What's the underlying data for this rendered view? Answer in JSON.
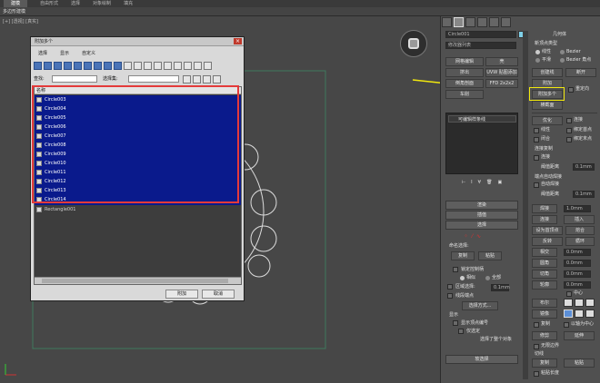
{
  "top_menu": [
    "建模",
    "自由形式",
    "选择",
    "对象绘制",
    "填充"
  ],
  "sub_bar": "多边形建模",
  "viewport_label": "[+] [透视] [真实]",
  "dialog": {
    "title": "附加多个",
    "menu": [
      "选择",
      "显示",
      "自定义"
    ],
    "find_label": "查找:",
    "selection_set_label": "选择集:",
    "list_header": "名称",
    "items": [
      {
        "name": "Circle003",
        "selected": true
      },
      {
        "name": "Circle004",
        "selected": true
      },
      {
        "name": "Circle005",
        "selected": true
      },
      {
        "name": "Circle006",
        "selected": true
      },
      {
        "name": "Circle007",
        "selected": true
      },
      {
        "name": "Circle008",
        "selected": true
      },
      {
        "name": "Circle009",
        "selected": true
      },
      {
        "name": "Circle010",
        "selected": true
      },
      {
        "name": "Circle011",
        "selected": true
      },
      {
        "name": "Circle012",
        "selected": true
      },
      {
        "name": "Circle013",
        "selected": true
      },
      {
        "name": "Circle014",
        "selected": true
      },
      {
        "name": "Rectangle001",
        "selected": false
      }
    ],
    "attach_button": "附加",
    "cancel_button": "取消"
  },
  "panel": {
    "object_name": "Circle001",
    "modifier_list": "修改器列表",
    "buttons_left": [
      "网格编辑",
      "挤出",
      "倒角剖面",
      "车削"
    ],
    "buttons_mid": [
      "壳",
      "UVW 贴图添加",
      "FFD 2x2x2",
      ""
    ],
    "stack_item": "可编辑样条线",
    "rollout_render": "渲染",
    "rollout_interp": "插值",
    "rollout_select": "选择",
    "rollout_soft": "软选择",
    "title_geom": "几何体",
    "new_vertex_type": "新顶点类型",
    "radio_linear": "线性",
    "radio_bezier": "Bezier",
    "radio_smooth": "平滑",
    "radio_bezier_corner": "Bezier 角点",
    "create_line": "创建线",
    "break": "断开",
    "attach": "附加",
    "attach_multiple": "附加多个",
    "reorient": "重定向",
    "cross_section": "横截面",
    "optimize": "优化",
    "connect": "连接",
    "linear": "线性",
    "bind_first": "绑定首点",
    "closed": "闭合",
    "bind_last": "绑定末点",
    "connect_copy": "连接复制",
    "threshold": "阈值距离",
    "threshold_value": "0.1mm",
    "end_auto_weld": "端点自动焊接",
    "auto_weld": "自动焊接",
    "weld_threshold": "阈值距离",
    "weld": "焊接",
    "weld_value": "0.1mm",
    "connect_btn": "连接",
    "insert": "插入",
    "set_first": "设为首顶点",
    "fuse": "熔合",
    "reverse": "反转",
    "cycle": "循环",
    "cross": "相交",
    "fillet": "圆角",
    "fillet_value": "0.0mm",
    "chamfer": "切角",
    "chamfer_value": "0.0mm",
    "outline": "轮廓",
    "outline_value": "0.0mm",
    "center": "中心",
    "boolean": "布尔",
    "mirror": "镜像",
    "copy": "复制",
    "about_pivot": "以轴为中心",
    "trim": "修剪",
    "extend": "延伸",
    "infinite_bounds": "无限边界",
    "tangent": "切线",
    "copy2": "复制",
    "paste": "粘贴",
    "paste_length": "粘贴长度",
    "named_sel": "命名选择:",
    "copy_btn": "复制",
    "paste_btn": "粘贴",
    "lock_handles": "锁定控制柄",
    "similar": "相似",
    "all": "全部",
    "area_select": "区域选择:",
    "area_value": "0.1mm",
    "segment_end": "线段端点",
    "select_by": "选择方式...",
    "display": "显示",
    "show_vertex_numbers": "显示顶点编号",
    "only_selected": "仅选定",
    "selected_count": "选择了整个对象",
    "value_1mm": "1.0mm",
    "value_0mm": "0.0mm"
  }
}
